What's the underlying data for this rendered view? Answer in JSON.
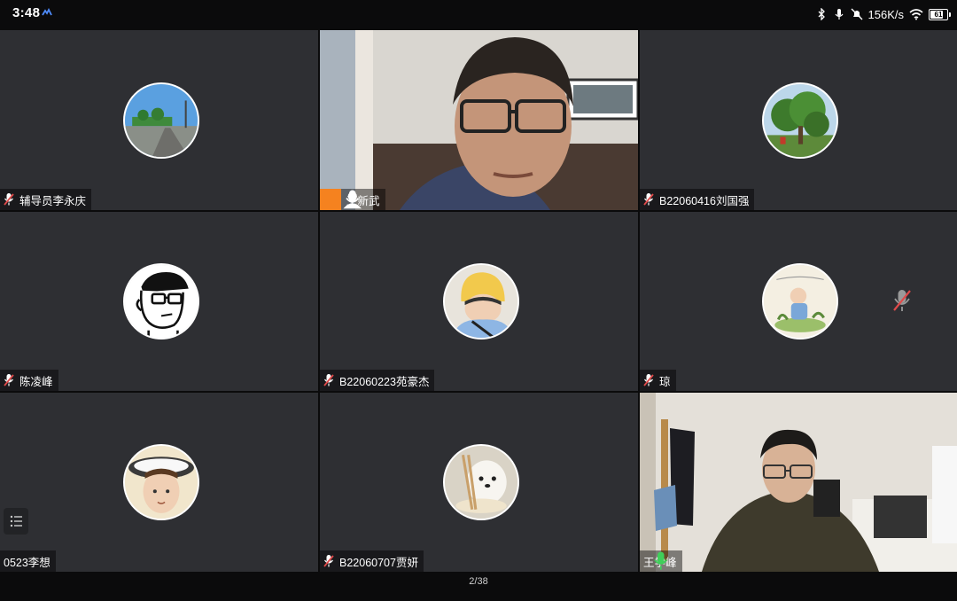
{
  "status_bar": {
    "time": "3:48",
    "net_speed": "156K/s",
    "battery_level": "61",
    "icons": [
      "bluetooth-icon",
      "mic-status-icon",
      "mute-bell-icon",
      "wifi-icon",
      "battery-icon"
    ]
  },
  "participants": [
    {
      "name": "辅导员李永庆",
      "mic": "muted",
      "type": "avatar",
      "avatar": "road-landscape"
    },
    {
      "name": "王新武",
      "mic": "on",
      "type": "video",
      "host": true
    },
    {
      "name": "B22060416刘国强",
      "mic": "muted",
      "type": "avatar",
      "avatar": "tree"
    },
    {
      "name": "陈凌峰",
      "mic": "muted",
      "type": "avatar",
      "avatar": "cartoon-glasses-man"
    },
    {
      "name": "B22060223苑豪杰",
      "mic": "muted",
      "type": "avatar",
      "avatar": "yellow-hat-child"
    },
    {
      "name": "琼",
      "mic": "muted",
      "type": "avatar",
      "avatar": "baby-painting"
    },
    {
      "name": "0523李想",
      "mic": "none",
      "type": "avatar",
      "avatar": "boy-with-hat"
    },
    {
      "name": "B22060707贾妍",
      "mic": "muted",
      "type": "avatar",
      "avatar": "white-dog"
    },
    {
      "name": "王学峰",
      "mic": "speaking",
      "type": "video",
      "active_speaker": true
    }
  ],
  "pager": {
    "label": "2/38"
  },
  "colors": {
    "tile_bg": "#2e2f33",
    "active_border": "#3fcf5a",
    "muted_red": "#e04a4a",
    "speaking_green": "#3fcf5a",
    "host_orange": "#f5821f"
  }
}
